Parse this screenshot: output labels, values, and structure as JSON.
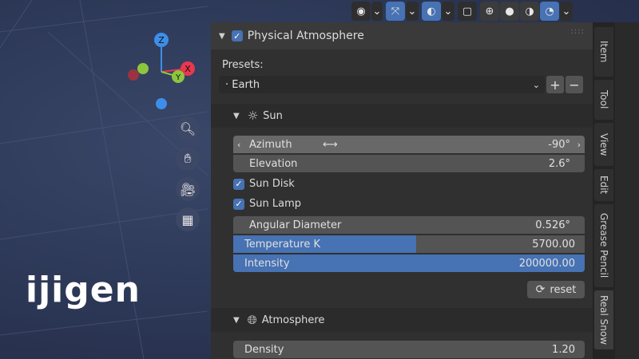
{
  "panel": {
    "title": "Physical Atmosphere",
    "presets_label": "Presets:",
    "preset_value": "· Earth",
    "add_label": "+",
    "remove_label": "−"
  },
  "sun": {
    "title": "Sun",
    "azimuth": {
      "label": "Azimuth",
      "value": "-90°"
    },
    "elevation": {
      "label": "Elevation",
      "value": "2.6°"
    },
    "sun_disk": "Sun Disk",
    "sun_lamp": "Sun Lamp",
    "angular_diameter": {
      "label": "Angular Diameter",
      "value": "0.526°"
    },
    "temperature": {
      "label": "Temperature K",
      "value": "5700.00",
      "fill_fraction": 0.52
    },
    "intensity": {
      "label": "Intensity",
      "value": "200000.00",
      "fill_fraction": 1.0
    },
    "reset_label": "reset"
  },
  "atmosphere": {
    "title": "Atmosphere",
    "density": {
      "label": "Density",
      "value": "1.20"
    }
  },
  "sidebar_tabs": [
    "Item",
    "Tool",
    "View",
    "Edit",
    "Grease Pencil",
    "Real Snow"
  ],
  "gizmo": {
    "z": "Z",
    "x": "X",
    "y": "Y"
  },
  "logo_text": "ijigen",
  "colors": {
    "accent": "#4772b3",
    "x_axis": "#e8384f",
    "y_axis": "#8cc63f",
    "z_axis": "#3d8ee8"
  }
}
